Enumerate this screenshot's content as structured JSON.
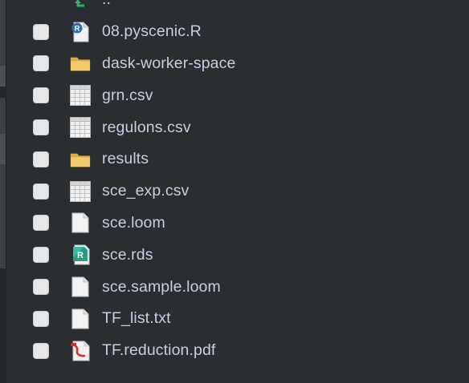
{
  "files": {
    "rows": [
      {
        "name": "..",
        "icon": "up-folder-icon"
      },
      {
        "name": "08.pyscenic.R",
        "icon": "r-script-icon"
      },
      {
        "name": "dask-worker-space",
        "icon": "folder-icon"
      },
      {
        "name": "grn.csv",
        "icon": "csv-table-icon"
      },
      {
        "name": "regulons.csv",
        "icon": "csv-table-icon"
      },
      {
        "name": "results",
        "icon": "folder-icon"
      },
      {
        "name": "sce_exp.csv",
        "icon": "csv-table-icon"
      },
      {
        "name": "sce.loom",
        "icon": "blank-file-icon"
      },
      {
        "name": "sce.rds",
        "icon": "rds-file-icon"
      },
      {
        "name": "sce.sample.loom",
        "icon": "blank-file-icon"
      },
      {
        "name": "TF_list.txt",
        "icon": "blank-file-icon"
      },
      {
        "name": "TF.reduction.pdf",
        "icon": "pdf-file-icon"
      }
    ]
  }
}
